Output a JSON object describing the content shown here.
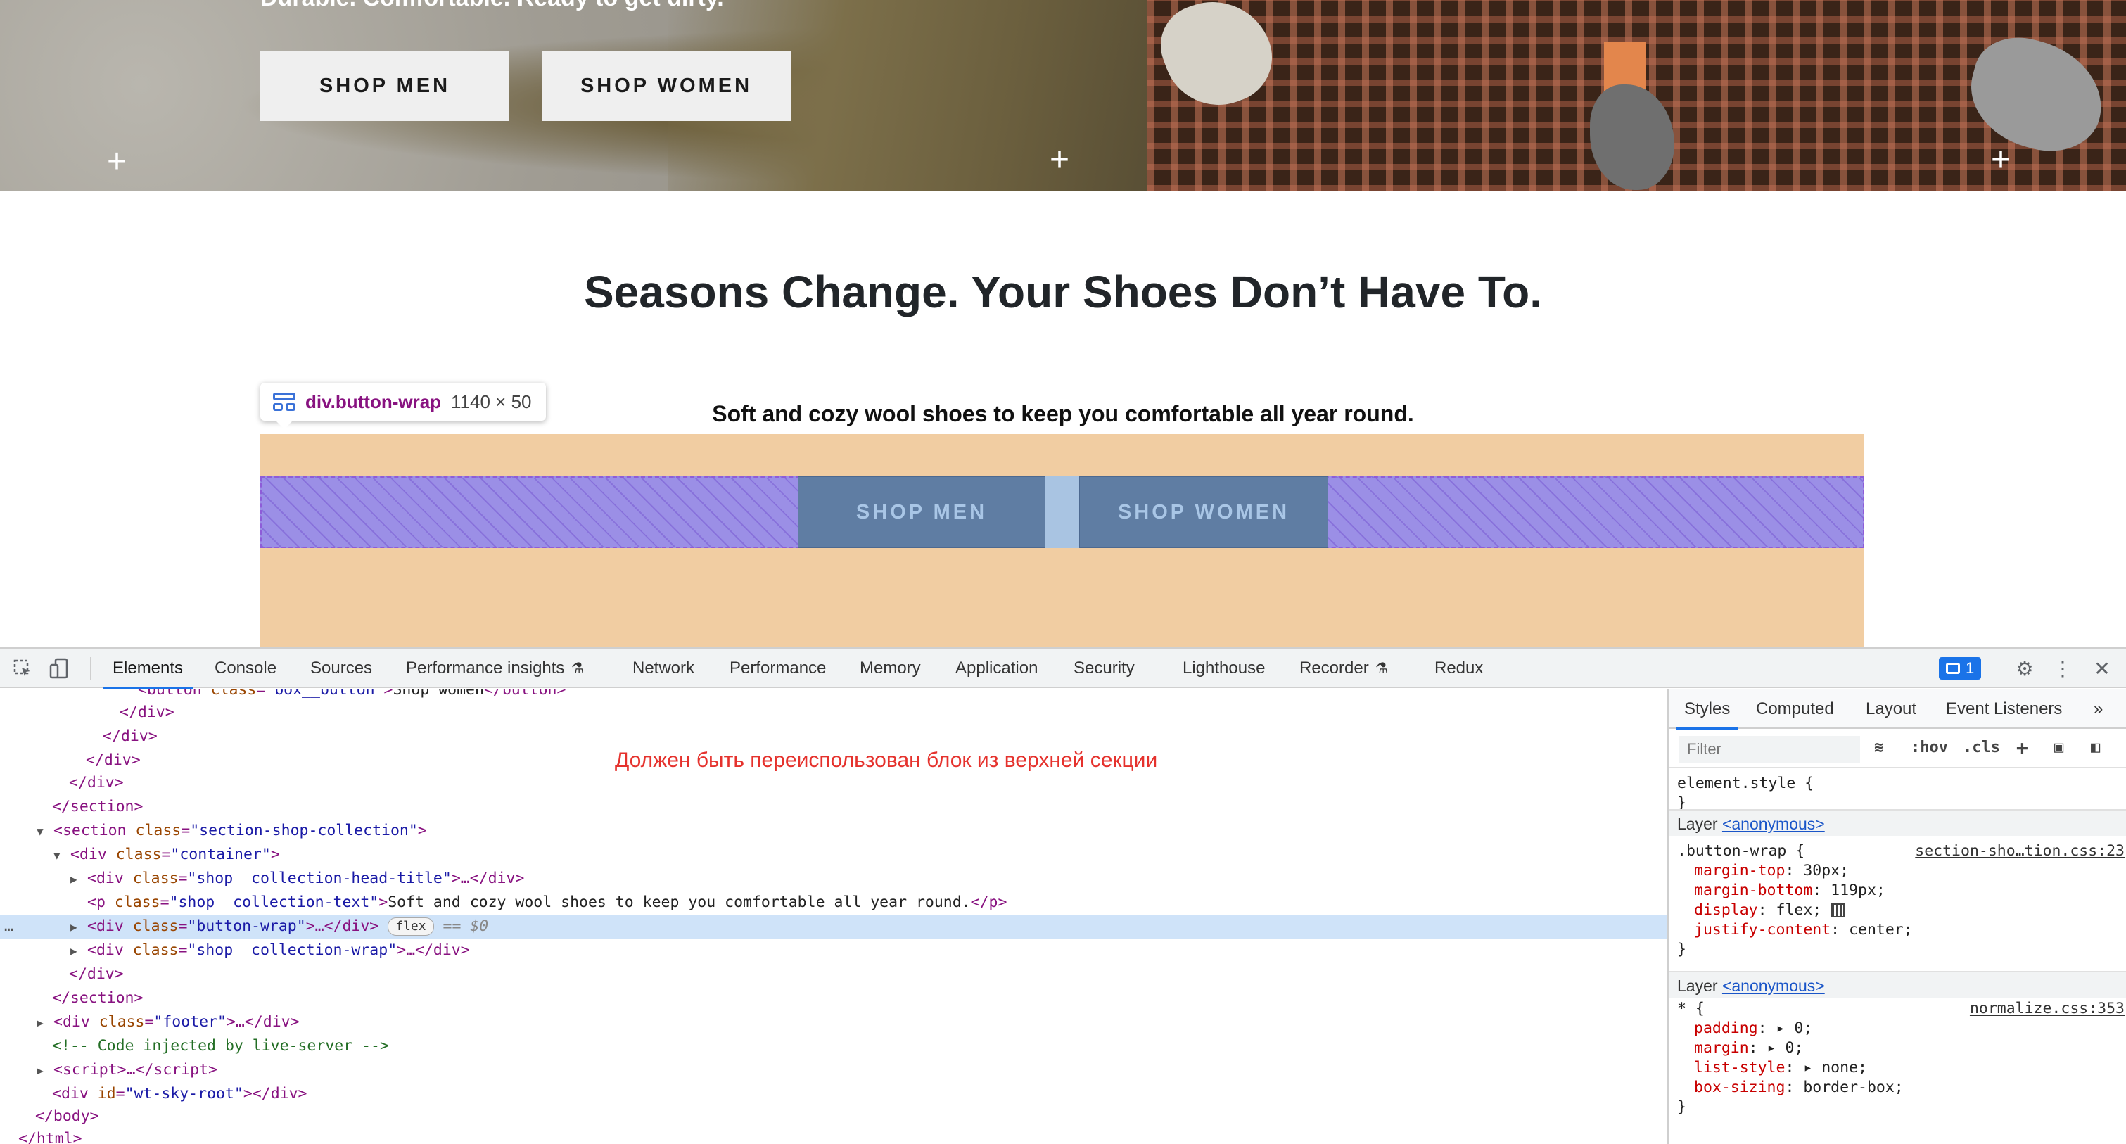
{
  "hero": {
    "tagline": "Durable. Comfortable. Ready to get dirty.",
    "shop_men": "SHOP MEN",
    "shop_women": "SHOP WOMEN"
  },
  "section": {
    "title": "Seasons Change. Your Shoes Don’t Have To.",
    "text": "Soft and cozy wool shoes to keep you comfortable all year round."
  },
  "overlay": {
    "tooltip_name": "div.button-wrap",
    "tooltip_size": "1140 × 50",
    "btn_men": "SHOP MEN",
    "btn_women": "SHOP WOMEN"
  },
  "devtools": {
    "tabs": [
      "Elements",
      "Console",
      "Sources",
      "Performance insights",
      "Network",
      "Performance",
      "Memory",
      "Application",
      "Security",
      "Lighthouse",
      "Recorder",
      "Redux"
    ],
    "issues_count": "1",
    "annotation": "Должен быть переиспользован блок из верхней секции",
    "dom": {
      "l0_attr": "class",
      "l0_val": "\"box__button\"",
      "l0_text": "Shop women",
      "section_class": "\"section-shop-collection\"",
      "container_class": "\"container\"",
      "head_title_class": "\"shop__collection-head-title\"",
      "text_class": "\"shop__collection-text\"",
      "text_content": "Soft and cozy wool shoes to keep you comfortable all year round.",
      "button_wrap_class": "\"button-wrap\"",
      "flex_chip": "flex",
      "selected_marker": "== $0",
      "wrap_class": "\"shop__collection-wrap\"",
      "footer_class": "\"footer\"",
      "comment": "<!-- Code injected by live-server -->",
      "root_id": "\"wt-sky-root\""
    },
    "styles": {
      "tabs": [
        "Styles",
        "Computed",
        "Layout",
        "Event Listeners"
      ],
      "filter_placeholder": "Filter",
      "hov": ":hov",
      "cls": ".cls",
      "element_style": "element.style {",
      "close_brace": "}",
      "layer_label": "Layer",
      "layer_link": "<anonymous>",
      "rule1": {
        "selector": ".button-wrap {",
        "source": "section-sho…tion.css:23",
        "props": [
          {
            "name": "margin-top",
            "value": "30px;"
          },
          {
            "name": "margin-bottom",
            "value": "119px;"
          },
          {
            "name": "display",
            "value": "flex;"
          },
          {
            "name": "justify-content",
            "value": "center;"
          }
        ]
      },
      "rule2": {
        "selector": "* {",
        "source": "normalize.css:353",
        "props": [
          {
            "name": "padding",
            "value": "0;"
          },
          {
            "name": "margin",
            "value": "0;"
          },
          {
            "name": "list-style",
            "value": "none;"
          },
          {
            "name": "box-sizing",
            "value": "border-box;"
          }
        ]
      }
    }
  }
}
